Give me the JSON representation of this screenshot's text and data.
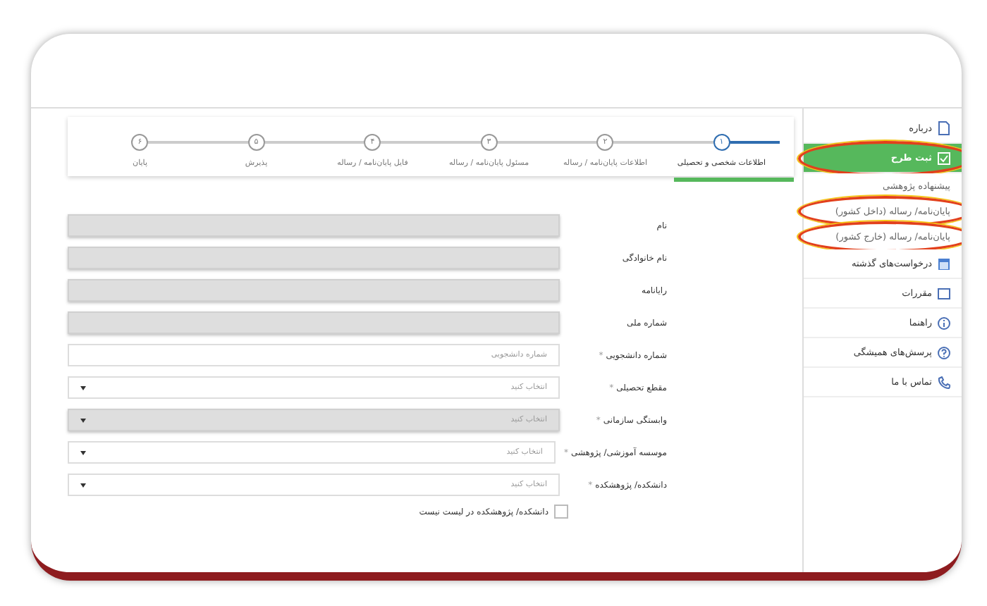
{
  "stepper": {
    "steps": [
      {
        "number": "۱",
        "label": "اطلاعات شخصی و تحصیلی",
        "selected": true
      },
      {
        "number": "۲",
        "label": "اطلاعات پایان‌نامه / رساله",
        "selected": false
      },
      {
        "number": "۳",
        "label": "مسئول پایان‌نامه / رساله",
        "selected": false
      },
      {
        "number": "۴",
        "label": "فایل پایان‌نامه / رساله",
        "selected": false
      },
      {
        "number": "۵",
        "label": "پذیرش",
        "selected": false
      },
      {
        "number": "۶",
        "label": "پایان",
        "selected": false
      }
    ]
  },
  "sidebar": {
    "items": [
      {
        "kind": "link",
        "label": "درباره",
        "selected": false,
        "highlighted": false
      },
      {
        "kind": "link",
        "label": "ثبت طرح",
        "selected": true,
        "highlighted": true
      },
      {
        "kind": "sub",
        "label": "پیشنهاده پژوهشی",
        "selected": false,
        "highlighted": false
      },
      {
        "kind": "sub",
        "label": "پایان‌نامه/ رساله (داخل کشور)",
        "selected": false,
        "highlighted": true
      },
      {
        "kind": "sub",
        "label": "پایان‌نامه/ رساله (خارج کشور)",
        "selected": false,
        "highlighted": true
      },
      {
        "kind": "link",
        "label": "درخواست‌های گذشته",
        "selected": false,
        "highlighted": false
      },
      {
        "kind": "link",
        "label": "مقررات",
        "selected": false,
        "highlighted": false
      },
      {
        "kind": "link",
        "label": "راهنما",
        "selected": false,
        "highlighted": false
      },
      {
        "kind": "link",
        "label": "پرسش‌های همیشگی",
        "selected": false,
        "highlighted": false
      },
      {
        "kind": "link",
        "label": "تماس با ما",
        "selected": false,
        "highlighted": false
      }
    ]
  },
  "form": {
    "fields": [
      {
        "kind": "text",
        "label": "نام",
        "disabled": true
      },
      {
        "kind": "text",
        "label": "نام خانوادگی",
        "disabled": true
      },
      {
        "kind": "text",
        "label": "رایانامه",
        "disabled": true
      },
      {
        "kind": "text",
        "label": "شماره ملی",
        "disabled": true
      },
      {
        "kind": "text",
        "label": "شماره دانشجویی",
        "required_mark": "*",
        "disabled": false,
        "placeholder": "شماره دانشجویی"
      },
      {
        "kind": "select",
        "label": "مقطع تحصیلی",
        "required_mark": "*",
        "disabled": false,
        "value": "انتخاب کنید"
      },
      {
        "kind": "select",
        "label": "وابستگی سازمانی",
        "required_mark": "*",
        "disabled": true,
        "value": "انتخاب کنید"
      },
      {
        "kind": "select",
        "label": "موسسه آموزشی/ پژوهشی",
        "required_mark": "*",
        "disabled": false,
        "value": "انتخاب کنید"
      },
      {
        "kind": "select",
        "label": "دانشکده/ پژوهشکده",
        "required_mark": "*",
        "disabled": false,
        "value": "انتخاب کنید"
      }
    ],
    "checkbox": {
      "label": "دانشکده/ پژوهشکده در لیست نیست",
      "checked": false
    }
  }
}
